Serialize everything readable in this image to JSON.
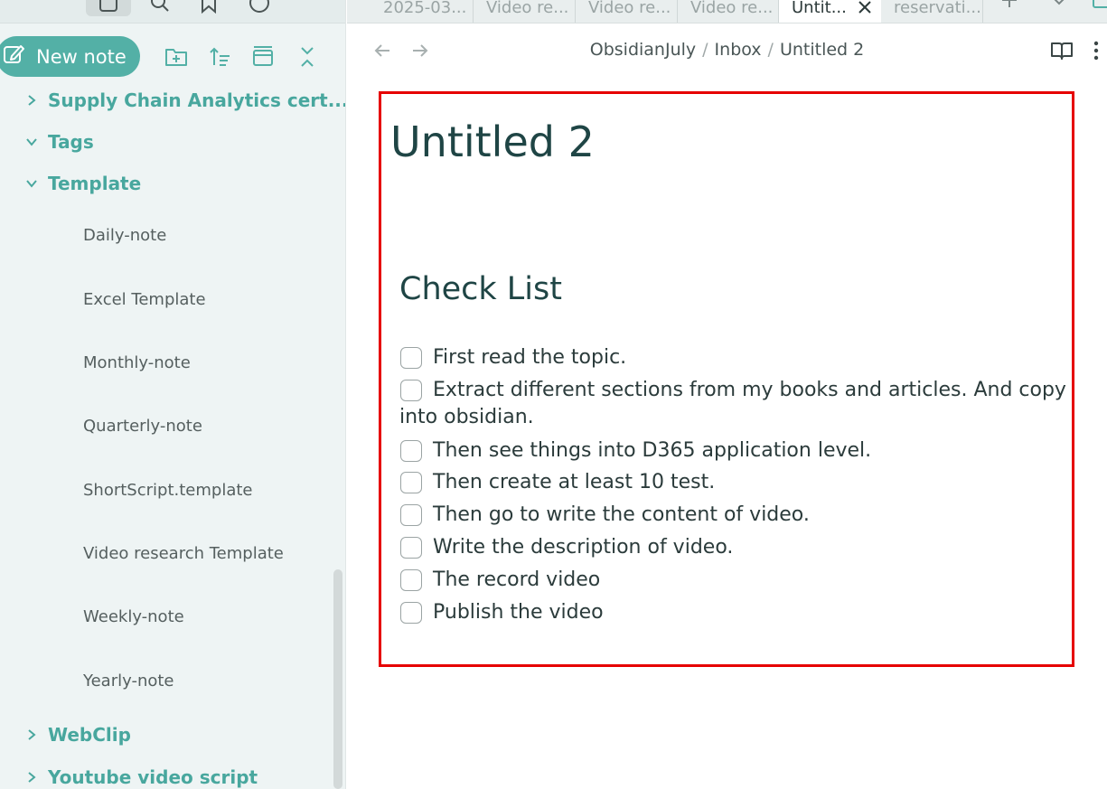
{
  "sidebar": {
    "top_icons": [
      "files-icon",
      "search-icon",
      "bookmark-icon",
      "graph-icon"
    ],
    "new_note_label": "New note",
    "actions": [
      "new-folder-icon",
      "sort-icon",
      "collapse-view-icon",
      "collapse-all-icon"
    ],
    "tree": [
      {
        "type": "folder",
        "label": "Supply Chain Analytics cert...",
        "expanded": false
      },
      {
        "type": "folder",
        "label": "Tags",
        "expanded": true
      },
      {
        "type": "folder",
        "label": "Template",
        "expanded": true
      },
      {
        "type": "file",
        "label": "Daily-note"
      },
      {
        "type": "file",
        "label": "Excel Template"
      },
      {
        "type": "file",
        "label": "Monthly-note"
      },
      {
        "type": "file",
        "label": "Quarterly-note"
      },
      {
        "type": "file",
        "label": "ShortScript.template"
      },
      {
        "type": "file",
        "label": "Video research Template"
      },
      {
        "type": "file",
        "label": "Weekly-note"
      },
      {
        "type": "file",
        "label": "Yearly-note"
      },
      {
        "type": "folder",
        "label": "WebClip",
        "expanded": false
      },
      {
        "type": "folder",
        "label": "Youtube video script",
        "expanded": false
      }
    ]
  },
  "tabs": [
    {
      "label": "2025-03...",
      "active": false
    },
    {
      "label": "Video re...",
      "active": false
    },
    {
      "label": "Video re...",
      "active": false
    },
    {
      "label": "Video re...",
      "active": false
    },
    {
      "label": "Untit...",
      "active": true
    },
    {
      "label": "reservati...",
      "active": false
    }
  ],
  "header": {
    "breadcrumb": [
      "ObsidianJuly",
      "Inbox",
      "Untitled 2"
    ],
    "separator": "/"
  },
  "note": {
    "title": "Untitled 2",
    "heading": "Check List",
    "tasks": [
      {
        "text": "First read the topic.",
        "checked": false
      },
      {
        "text": "Extract different sections from my books and articles. And copy",
        "continuation": "into obsidian.",
        "checked": false
      },
      {
        "text": "Then see things into D365 application level.",
        "checked": false
      },
      {
        "text": "Then create at least 10 test.",
        "checked": false
      },
      {
        "text": "Then go to write the content of video.",
        "checked": false
      },
      {
        "text": "Write the description of video.",
        "checked": false
      },
      {
        "text": "The record video",
        "checked": false
      },
      {
        "text": "Publish the video",
        "checked": false
      }
    ]
  },
  "colors": {
    "accent": "#53b0a6",
    "folder_text": "#48a79e",
    "highlight_frame": "#e60000",
    "heading_text": "#1f4545"
  }
}
